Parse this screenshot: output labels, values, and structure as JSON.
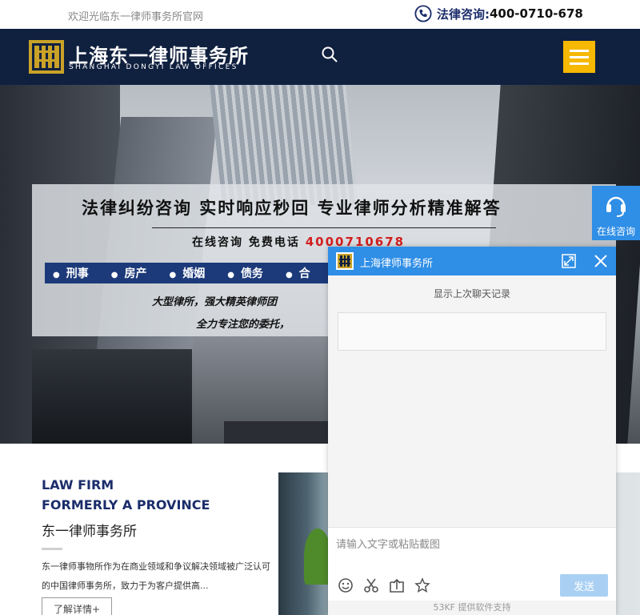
{
  "topbar": {
    "welcome": "欢迎光临东一律师事务所官网",
    "hotline_label": "法律咨询:",
    "hotline_number": "400-0710-678",
    "phone_icon": "phone-icon"
  },
  "header": {
    "brand_cn": "上海东一律师事务所",
    "brand_en": "SHANGHAI DONGYI LAW OFFICES",
    "search_icon": "search-icon",
    "menu_icon": "hamburger-menu-icon",
    "logo_color": "#c9a227",
    "menu_color": "#f6b800"
  },
  "banner": {
    "title": "法律纠纷咨询  实时响应秒回  专业律师分析精准解答",
    "sub_prefix": "在线咨询  免费电话",
    "sub_phone": "4000710678",
    "tags": [
      "刑事",
      "房产",
      "婚姻",
      "债务",
      "合"
    ],
    "line1": "大型律所，强大精英律师团",
    "line2": "全力专注您的委托，"
  },
  "intro": {
    "heading_line1": "LAW FIRM",
    "heading_line2": "FORMERLY A PROVINCE",
    "name": "东一律师事务所",
    "text": "东一律师事物所作为在商业领域和争议解决领域被广泛认可的中国律师事务所，致力于为客户提供高...",
    "more_label": "了解详情+"
  },
  "float_consult": {
    "label": "在线咨询",
    "icon": "headset-icon"
  },
  "chat": {
    "title": "上海律师事务所",
    "history_label": "显示上次聊天记录",
    "input_placeholder": "请输入文字或粘贴截图",
    "send_label": "发送",
    "footer": "53KF 提供软件支持",
    "tools": [
      "emoji-icon",
      "scissors-icon",
      "upload-icon",
      "star-icon"
    ],
    "header_color": "#2f8ee6"
  }
}
